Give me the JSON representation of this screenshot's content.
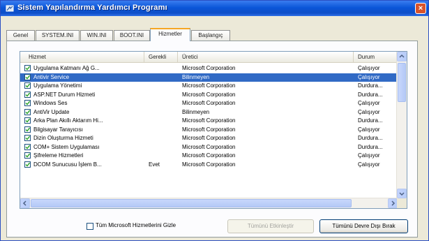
{
  "window": {
    "title": "Sistem Yapılandırma Yardımcı Programı",
    "close": "×"
  },
  "tabs": [
    "Genel",
    "SYSTEM.INI",
    "WIN.INI",
    "BOOT.INI",
    "Hizmetler",
    "Başlangıç"
  ],
  "active_tab": "Hizmetler",
  "columns": [
    "Hizmet",
    "Gerekli",
    "Üretici",
    "Durum"
  ],
  "rows": [
    {
      "name": "Uygulama Katmanı Ağ G...",
      "essential": "",
      "vendor": "Microsoft Corporation",
      "status": "Çalışıyor",
      "checked": true,
      "selected": false
    },
    {
      "name": "Antivir Service",
      "essential": "",
      "vendor": "Bilinmeyen",
      "status": "Çalışıyor",
      "checked": true,
      "selected": true
    },
    {
      "name": "Uygulama Yönetimi",
      "essential": "",
      "vendor": "Microsoft Corporation",
      "status": "Durdura...",
      "checked": true,
      "selected": false
    },
    {
      "name": "ASP.NET Durum Hizmeti",
      "essential": "",
      "vendor": "Microsoft Corporation",
      "status": "Durdura...",
      "checked": true,
      "selected": false
    },
    {
      "name": "Windows Ses",
      "essential": "",
      "vendor": "Microsoft Corporation",
      "status": "Çalışıyor",
      "checked": true,
      "selected": false
    },
    {
      "name": "AntiVir Update",
      "essential": "",
      "vendor": "Bilinmeyen",
      "status": "Çalışıyor",
      "checked": true,
      "selected": false
    },
    {
      "name": "Arka Plan Akıllı Aktarım Hi...",
      "essential": "",
      "vendor": "Microsoft Corporation",
      "status": "Durdura...",
      "checked": true,
      "selected": false
    },
    {
      "name": "Bilgisayar Tarayıcısı",
      "essential": "",
      "vendor": "Microsoft Corporation",
      "status": "Çalışıyor",
      "checked": true,
      "selected": false
    },
    {
      "name": "Dizin Oluşturma Hizmeti",
      "essential": "",
      "vendor": "Microsoft Corporation",
      "status": "Durdura...",
      "checked": true,
      "selected": false
    },
    {
      "name": "COM+ Sistem Uygulaması",
      "essential": "",
      "vendor": "Microsoft Corporation",
      "status": "Durdura...",
      "checked": true,
      "selected": false
    },
    {
      "name": "Şifreleme Hizmetleri",
      "essential": "",
      "vendor": "Microsoft Corporation",
      "status": "Çalışıyor",
      "checked": true,
      "selected": false
    },
    {
      "name": "DCOM Sunucusu İşlem B...",
      "essential": "Evet",
      "vendor": "Microsoft Corporation",
      "status": "Çalışıyor",
      "checked": true,
      "selected": false
    }
  ],
  "bottom": {
    "hide_ms_label": "Tüm Microsoft Hizmetlerini Gizle",
    "enable_all": "Tümünü Etkinleştir",
    "disable_all": "Tümünü Devre Dışı Bırak"
  },
  "colors": {
    "titlebar": "#0b56d8",
    "selection": "#316ac5"
  }
}
